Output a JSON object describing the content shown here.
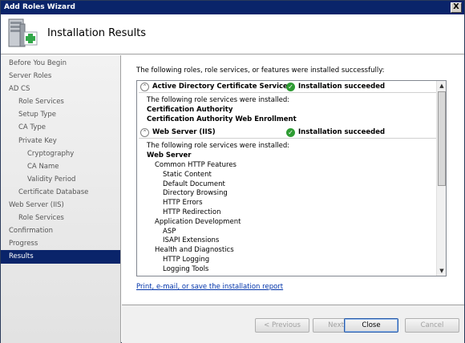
{
  "window": {
    "title": "Add Roles Wizard",
    "close_glyph": "X"
  },
  "header": {
    "title": "Installation Results",
    "icon": "server-roles-add-icon"
  },
  "nav": {
    "items": [
      {
        "label": "Before You Begin",
        "level": 0
      },
      {
        "label": "Server Roles",
        "level": 0
      },
      {
        "label": "AD CS",
        "level": 0
      },
      {
        "label": "Role Services",
        "level": 1
      },
      {
        "label": "Setup Type",
        "level": 1
      },
      {
        "label": "CA Type",
        "level": 1
      },
      {
        "label": "Private Key",
        "level": 1
      },
      {
        "label": "Cryptography",
        "level": 2
      },
      {
        "label": "CA Name",
        "level": 2
      },
      {
        "label": "Validity Period",
        "level": 2
      },
      {
        "label": "Certificate Database",
        "level": 1
      },
      {
        "label": "Web Server (IIS)",
        "level": 0
      },
      {
        "label": "Role Services",
        "level": 1
      },
      {
        "label": "Confirmation",
        "level": 0
      },
      {
        "label": "Progress",
        "level": 0
      },
      {
        "label": "Results",
        "level": 0,
        "active": true
      }
    ]
  },
  "content": {
    "intro": "The following roles, role services, or features were installed successfully:",
    "roles": [
      {
        "name": "Active Directory Certificate Services",
        "status": "Installation succeeded",
        "subtitle": "The following role services were installed:",
        "services": [
          {
            "text": "Certification Authority",
            "level": 0,
            "bold": true
          },
          {
            "text": "Certification Authority Web Enrollment",
            "level": 0,
            "bold": true
          }
        ]
      },
      {
        "name": "Web Server (IIS)",
        "status": "Installation succeeded",
        "subtitle": "The following role services were installed:",
        "services": [
          {
            "text": "Web Server",
            "level": 0,
            "bold": true
          },
          {
            "text": "Common HTTP Features",
            "level": 1
          },
          {
            "text": "Static Content",
            "level": 2
          },
          {
            "text": "Default Document",
            "level": 2
          },
          {
            "text": "Directory Browsing",
            "level": 2
          },
          {
            "text": "HTTP Errors",
            "level": 2
          },
          {
            "text": "HTTP Redirection",
            "level": 2
          },
          {
            "text": "Application Development",
            "level": 1
          },
          {
            "text": "ASP",
            "level": 2
          },
          {
            "text": "ISAPI Extensions",
            "level": 2
          },
          {
            "text": "Health and Diagnostics",
            "level": 1
          },
          {
            "text": "HTTP Logging",
            "level": 2
          },
          {
            "text": "Logging Tools",
            "level": 2
          }
        ]
      }
    ],
    "report_link": "Print, e-mail, or save the installation report",
    "scroll": {
      "up_glyph": "▲",
      "down_glyph": "▼"
    },
    "collapse_glyph": "⌃",
    "status_glyph": "✓"
  },
  "footer": {
    "previous": "< Previous",
    "next": "Next >",
    "close": "Close",
    "cancel": "Cancel"
  },
  "colors": {
    "title_bar": "#0a246a",
    "selection": "#0a246a",
    "success": "#2e9c33",
    "link": "#0033aa"
  }
}
